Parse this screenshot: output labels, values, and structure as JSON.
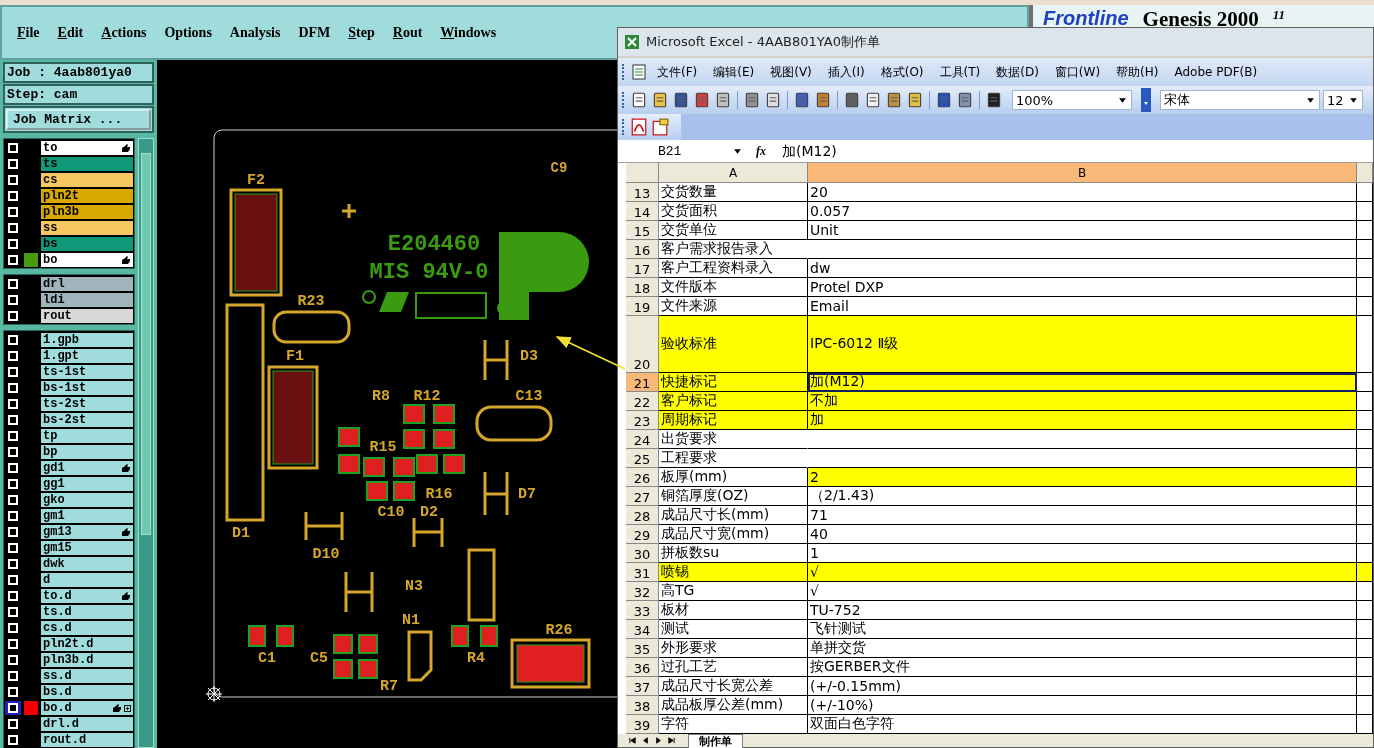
{
  "genesis": {
    "menu": [
      {
        "label": "File",
        "underlined": true
      },
      {
        "label": "Edit",
        "underlined": true
      },
      {
        "label": "Actions",
        "underlined": true
      },
      {
        "label": "Options",
        "underlined": false
      },
      {
        "label": "Analysis",
        "underlined": false
      },
      {
        "label": "DFM",
        "underlined": false
      },
      {
        "label": "Step",
        "underlined": true
      },
      {
        "label": "Rout",
        "underlined": true
      },
      {
        "label": "Windows",
        "underlined": true
      }
    ],
    "logo": {
      "brand": "Frontline",
      "product": "Genesis 2000",
      "version": "11"
    },
    "job": "Job : 4aab801ya0",
    "step": "Step: cam",
    "matrix_button": "Job Matrix ...",
    "layer_groups": [
      {
        "layers": [
          {
            "name": "to",
            "color": "#ffffff",
            "affected": true,
            "selected": false
          },
          {
            "name": "ts",
            "color": "#109878",
            "affected": false,
            "selected": false
          },
          {
            "name": "cs",
            "color": "#f8c860",
            "affected": false,
            "selected": false
          },
          {
            "name": "pln2t",
            "color": "#d8a800",
            "affected": false,
            "selected": false
          },
          {
            "name": "pln3b",
            "color": "#d8a800",
            "affected": false,
            "selected": false
          },
          {
            "name": "ss",
            "color": "#f8c860",
            "affected": false,
            "selected": false
          },
          {
            "name": "bs",
            "color": "#109878",
            "affected": false,
            "selected": false
          },
          {
            "name": "bo",
            "color": "#ffffff",
            "affected": true,
            "selected": false,
            "swatch": {
              "color": "#4a9a10"
            }
          }
        ]
      },
      {
        "layers": [
          {
            "name": "drl",
            "color": "#a0b4bc",
            "affected": false,
            "selected": false
          },
          {
            "name": "ldi",
            "color": "#a0b4bc",
            "affected": false,
            "selected": false
          },
          {
            "name": "rout",
            "color": "#d8d8d8",
            "affected": false,
            "selected": false
          }
        ]
      },
      {
        "layers": [
          {
            "name": "1.gpb",
            "color": "#a0dcdc",
            "affected": false,
            "selected": false
          },
          {
            "name": "1.gpt",
            "color": "#a0dcdc",
            "affected": false,
            "selected": false
          },
          {
            "name": "ts-1st",
            "color": "#a0dcdc",
            "affected": false,
            "selected": false
          },
          {
            "name": "bs-1st",
            "color": "#a0dcdc",
            "affected": false,
            "selected": false
          },
          {
            "name": "ts-2st",
            "color": "#a0dcdc",
            "affected": false,
            "selected": false
          },
          {
            "name": "bs-2st",
            "color": "#a0dcdc",
            "affected": false,
            "selected": false
          },
          {
            "name": "tp",
            "color": "#a0dcdc",
            "affected": false,
            "selected": false
          },
          {
            "name": "bp",
            "color": "#a0dcdc",
            "affected": false,
            "selected": false
          },
          {
            "name": "gd1",
            "color": "#a0dcdc",
            "affected": true,
            "selected": false
          },
          {
            "name": "gg1",
            "color": "#a0dcdc",
            "affected": false,
            "selected": false
          },
          {
            "name": "gko",
            "color": "#a0dcdc",
            "affected": false,
            "selected": false
          },
          {
            "name": "gm1",
            "color": "#a0dcdc",
            "affected": false,
            "selected": false
          },
          {
            "name": "gm13",
            "color": "#a0dcdc",
            "affected": true,
            "selected": false
          },
          {
            "name": "gm15",
            "color": "#a0dcdc",
            "affected": false,
            "selected": false
          },
          {
            "name": "dwk",
            "color": "#a0dcdc",
            "affected": false,
            "selected": false
          },
          {
            "name": "d",
            "color": "#a0dcdc",
            "affected": false,
            "selected": false
          },
          {
            "name": "to.d",
            "color": "#a0dcdc",
            "affected": true,
            "selected": false
          },
          {
            "name": "ts.d",
            "color": "#a0dcdc",
            "affected": false,
            "selected": false
          },
          {
            "name": "cs.d",
            "color": "#a0dcdc",
            "affected": false,
            "selected": false
          },
          {
            "name": "pln2t.d",
            "color": "#a0dcdc",
            "affected": false,
            "selected": false
          },
          {
            "name": "pln3b.d",
            "color": "#a0dcdc",
            "affected": false,
            "selected": false
          },
          {
            "name": "ss.d",
            "color": "#a0dcdc",
            "affected": false,
            "selected": false
          },
          {
            "name": "bs.d",
            "color": "#a0dcdc",
            "affected": false,
            "selected": false
          },
          {
            "name": "bo.d",
            "color": "#a0dcdc",
            "affected": true,
            "selected": true,
            "swatch": {
              "color": "#f00000"
            },
            "expandable": true
          },
          {
            "name": "drl.d",
            "color": "#a0dcdc",
            "affected": false,
            "selected": false
          },
          {
            "name": "rout.d",
            "color": "#a0dcdc",
            "affected": false,
            "selected": false
          }
        ]
      }
    ],
    "silkscreen_labels": [
      "C9",
      "F2",
      "E204460",
      "MIS 94V-0",
      "R23",
      "F1",
      "D3",
      "R8",
      "R12",
      "C13",
      "R15",
      "R16",
      "D7",
      "C10",
      "D2",
      "D1",
      "D10",
      "N3",
      "N1",
      "R26",
      "C1",
      "C5",
      "R4",
      "R7"
    ]
  },
  "excel": {
    "title": "Microsoft Excel - 4AAB801YA0制作单",
    "menu": [
      "文件(F)",
      "编辑(E)",
      "视图(V)",
      "插入(I)",
      "格式(O)",
      "工具(T)",
      "数据(D)",
      "窗口(W)",
      "帮助(H)",
      "Adobe PDF(B)"
    ],
    "zoom": "100%",
    "font": "宋体",
    "font_size": "12",
    "name_box": "B21",
    "fx": "fx",
    "formula": "加(M12)",
    "columns": [
      {
        "label": "A",
        "selected": false
      },
      {
        "label": "B",
        "selected": true
      }
    ],
    "rows": [
      {
        "row": "13",
        "label": "交货数量",
        "value": "20",
        "label_highlighted": false,
        "value_highlighted": false,
        "beyond_highlighted": false,
        "selected": false
      },
      {
        "row": "14",
        "label": "交货面积",
        "value": "0.057",
        "label_highlighted": false,
        "value_highlighted": false,
        "beyond_highlighted": false,
        "selected": false
      },
      {
        "row": "15",
        "label": "交货单位",
        "value": "Unit",
        "label_highlighted": false,
        "value_highlighted": false,
        "beyond_highlighted": false,
        "selected": false
      },
      {
        "row": "16",
        "label": "客户需求报告录入",
        "label_highlighted": false,
        "value_highlighted": false,
        "beyond_highlighted": false,
        "selected": false
      },
      {
        "row": "17",
        "label": "客户工程资料录入",
        "value": "dw",
        "label_highlighted": false,
        "value_highlighted": false,
        "beyond_highlighted": false,
        "selected": false
      },
      {
        "row": "18",
        "label": "文件版本",
        "value": "Protel DXP",
        "label_highlighted": false,
        "value_highlighted": false,
        "beyond_highlighted": false,
        "selected": false
      },
      {
        "row": "19",
        "label": "文件来源",
        "value": "Email",
        "label_highlighted": false,
        "value_highlighted": false,
        "beyond_highlighted": false,
        "selected": false
      },
      {
        "row": "20",
        "label": "验收标准",
        "value": "IPC-6012 Ⅱ级",
        "label_highlighted": true,
        "value_highlighted": true,
        "beyond_highlighted": false,
        "selected": false,
        "tall": true
      },
      {
        "row": "21",
        "label": "快捷标记",
        "value": "加(M12)",
        "label_highlighted": true,
        "value_highlighted": true,
        "beyond_highlighted": false,
        "selected": true
      },
      {
        "row": "22",
        "label": "客户标记",
        "value": "不加",
        "label_highlighted": true,
        "value_highlighted": true,
        "beyond_highlighted": false,
        "selected": false
      },
      {
        "row": "23",
        "label": "周期标记",
        "value": "加",
        "label_highlighted": true,
        "value_highlighted": true,
        "beyond_highlighted": false,
        "selected": false
      },
      {
        "row": "24",
        "label": "出货要求",
        "label_highlighted": false,
        "value_highlighted": false,
        "beyond_highlighted": false,
        "selected": false
      },
      {
        "row": "25",
        "label": "工程要求",
        "label_highlighted": false,
        "value_highlighted": false,
        "beyond_highlighted": false,
        "selected": false
      },
      {
        "row": "26",
        "label": "板厚(mm)",
        "value": "2",
        "label_highlighted": false,
        "value_highlighted": true,
        "beyond_highlighted": false,
        "selected": false
      },
      {
        "row": "27",
        "label": "铜箔厚度(OZ)",
        "value": "（2/1.43)",
        "label_highlighted": false,
        "value_highlighted": false,
        "beyond_highlighted": false,
        "selected": false
      },
      {
        "row": "28",
        "label": "成品尺寸长(mm)",
        "value": "71",
        "label_highlighted": false,
        "value_highlighted": false,
        "beyond_highlighted": false,
        "selected": false
      },
      {
        "row": "29",
        "label": "成品尺寸宽(mm)",
        "value": "40",
        "label_highlighted": false,
        "value_highlighted": false,
        "beyond_highlighted": false,
        "selected": false
      },
      {
        "row": "30",
        "label": "拼板数su",
        "value": "1",
        "label_highlighted": false,
        "value_highlighted": false,
        "beyond_highlighted": false,
        "selected": false
      },
      {
        "row": "31",
        "label": "喷锡",
        "value": "√",
        "label_highlighted": true,
        "value_highlighted": true,
        "beyond_highlighted": true,
        "selected": false
      },
      {
        "row": "32",
        "label": "高TG",
        "value": "√",
        "label_highlighted": false,
        "value_highlighted": false,
        "beyond_highlighted": false,
        "selected": false
      },
      {
        "row": "33",
        "label": "板材",
        "value": "TU-752",
        "label_highlighted": false,
        "value_highlighted": false,
        "beyond_highlighted": false,
        "selected": false
      },
      {
        "row": "34",
        "label": "测试",
        "value": "飞针测试",
        "label_highlighted": false,
        "value_highlighted": false,
        "beyond_highlighted": false,
        "selected": false
      },
      {
        "row": "35",
        "label": "外形要求",
        "value": "单拼交货",
        "label_highlighted": false,
        "value_highlighted": false,
        "beyond_highlighted": false,
        "selected": false
      },
      {
        "row": "36",
        "label": "过孔工艺",
        "value": "按GERBER文件",
        "label_highlighted": false,
        "value_highlighted": false,
        "beyond_highlighted": false,
        "selected": false
      },
      {
        "row": "37",
        "label": "成品尺寸长宽公差",
        "value": "(+/-0.15mm)",
        "label_highlighted": false,
        "value_highlighted": false,
        "beyond_highlighted": false,
        "selected": false
      },
      {
        "row": "38",
        "label": "成品板厚公差(mm)",
        "value": "(+/-10%)",
        "label_highlighted": false,
        "value_highlighted": false,
        "beyond_highlighted": false,
        "selected": false
      },
      {
        "row": "39",
        "label": "字符",
        "value": "双面白色字符",
        "label_highlighted": false,
        "value_highlighted": false,
        "beyond_highlighted": false,
        "selected": false
      }
    ],
    "sheets": [
      {
        "label": "制作单",
        "selected": true
      }
    ]
  }
}
